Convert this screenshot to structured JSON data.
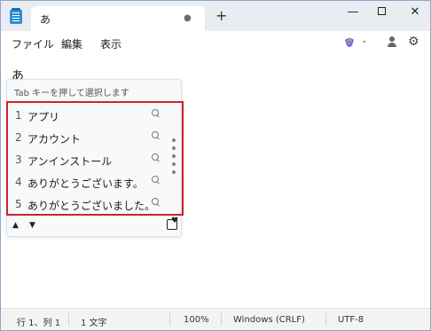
{
  "window": {
    "tab_title": "あ",
    "tab_modified": "●",
    "new_tab": "+",
    "minimize": "—",
    "close": "✕"
  },
  "menu": {
    "file": "ファイル",
    "edit": "編集",
    "view": "表示",
    "copilot_chevron": "⌄",
    "settings_icon": "⚙"
  },
  "editor": {
    "content": "あ"
  },
  "ime": {
    "hint": "Tab キーを押して選択します",
    "candidates": [
      {
        "num": "1",
        "text": "アプリ"
      },
      {
        "num": "2",
        "text": "アカウント"
      },
      {
        "num": "3",
        "text": "アンインストール"
      },
      {
        "num": "4",
        "text": "ありがとうございます。"
      },
      {
        "num": "5",
        "text": "ありがとうございました。"
      }
    ],
    "prev_arrow": "▲",
    "next_arrow": "▼",
    "favorite_heart": "♥",
    "highlight_color": "#d4202a"
  },
  "status": {
    "position": "行 1、列 1",
    "chars": "1 文字",
    "zoom": "100%",
    "line_ending": "Windows (CRLF)",
    "encoding": "UTF-8"
  }
}
